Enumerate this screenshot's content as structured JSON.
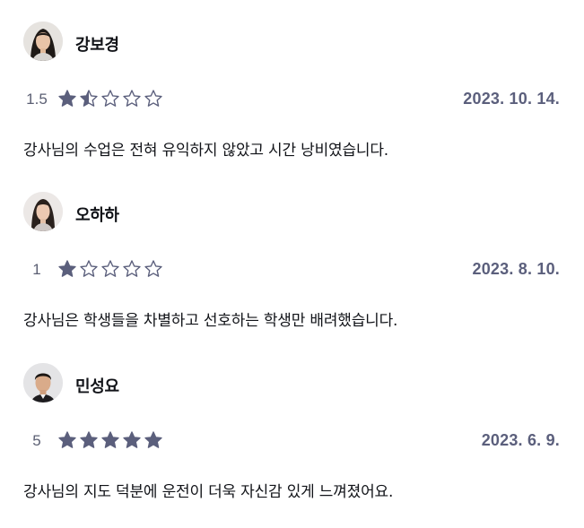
{
  "reviews": [
    {
      "name": "강보경",
      "rating": "1.5",
      "rating_value": 1.5,
      "date": "2023. 10. 14.",
      "text": "강사님의 수업은 전혀 유익하지 않았고 시간 낭비였습니다.",
      "avatar_icon": "person-avatar-icon"
    },
    {
      "name": "오하하",
      "rating": "1",
      "rating_value": 1,
      "date": "2023. 8. 10.",
      "text": "강사님은 학생들을 차별하고 선호하는 학생만 배려했습니다.",
      "avatar_icon": "person-avatar-icon"
    },
    {
      "name": "민성요",
      "rating": "5",
      "rating_value": 5,
      "date": "2023. 6. 9.",
      "text": "강사님의 지도 덕분에 운전이 더욱 자신감 있게 느껴졌어요.",
      "avatar_icon": "person-avatar-icon"
    }
  ],
  "colors": {
    "star": "#5b5f7c",
    "date": "#5b5f7c",
    "text": "#111318"
  }
}
